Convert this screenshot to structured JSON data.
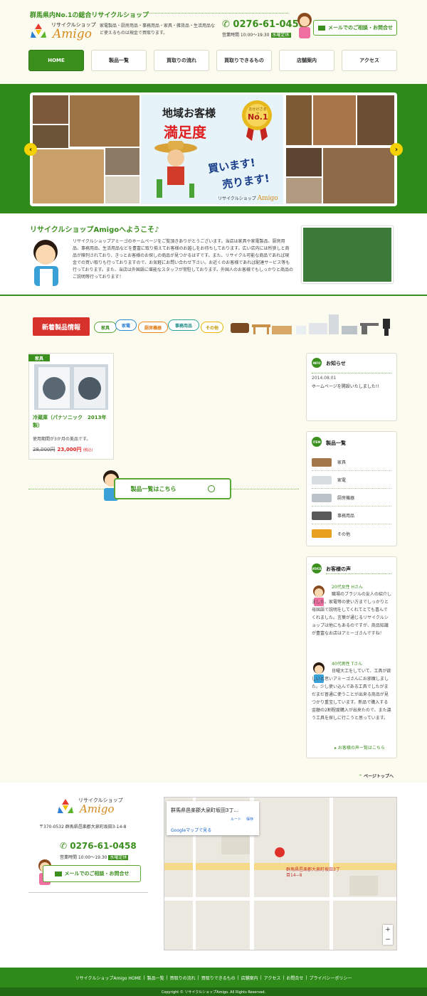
{
  "header": {
    "tagline": "群馬県内No.1の総合リサイクルショップ",
    "logo_sub": "リサイクルショップ",
    "logo_main": "Amigo",
    "description": "家電製品・厨房用品・事務用品・家具・雑貨品・生活用品など使えるものは現金で買取ります。",
    "phone": "0276-61-0458",
    "hours": "営業時間 10:00～19:30",
    "closed": "水曜定休",
    "mail_button": "メールでのご相談・お問合せ"
  },
  "nav": [
    {
      "label": "HOME",
      "active": true
    },
    {
      "label": "製品一覧"
    },
    {
      "label": "買取りの流れ"
    },
    {
      "label": "買取りできるもの"
    },
    {
      "label": "店舗案内"
    },
    {
      "label": "アクセス"
    }
  ],
  "banner": {
    "title1": "地域お客様",
    "title2": "満足度",
    "medal_top": "おかげさまで",
    "medal_no": "No.1",
    "kaimasu": "買います!",
    "urimasu": "売ります!",
    "logo_sub": "リサイクルショップ",
    "logo_main": "Amigo",
    "prev_arrow": "‹",
    "next_arrow": "›"
  },
  "welcome": {
    "title": "リサイクルショップAmigoへようこそ♪",
    "text": "リサイクルショップアミーゴのホームページをご覧頂きありがとうございます。当店は家具や家電製品、厨房用品、事務用品、生活用品などを豊富に取り揃えてお客様のお越しをお待ちしております。広い店内には所狭しと商品が陳列されており、きっとお客様のお探しの商品が見つかるはずです。また、リサイクル可能な商品であれば現金での買い取りも行っておりますので、お気軽にお問い合わせ下さい。お近くのお客様であれば配達サービス等も行っております。また、当店は外国語に堪能なスタッフが常駐しております。外国人のお客様でもしっかりと商品のご説明等行っております！"
  },
  "new_items": {
    "label": "新着製品情報",
    "categories": [
      "家具",
      "家電",
      "厨房機器",
      "事務用品",
      "その他"
    ]
  },
  "product": {
    "tag": "家具",
    "name": "冷蔵庫（パナソニック　2013年製）",
    "note": "使用期間が3か月の美品です。",
    "old_price": "28,000円",
    "new_price": "23,000円",
    "tax": "(税込)"
  },
  "list_button": "製品一覧はこちら",
  "sidebar": {
    "info_badge": "INFO",
    "info_title": "お知らせ",
    "info_date": "2014.08.01",
    "info_text": "ホームページを開設いたしました!!",
    "item_badge": "ITEM",
    "item_title": "製品一覧",
    "items": [
      "家具",
      "家電",
      "厨房機器",
      "事務用品",
      "その他"
    ],
    "voice_badge": "VOICE",
    "voice_title": "お客様の声",
    "voices": [
      {
        "author": "20代女性 Hさん",
        "text": "職場のブラジルの友人の紹介しました。家電等の使い方までしっかりと母国語で説明をしてくれてとても喜んでくれました。言葉が通じるリサイクルショップは他にもあるのですが、商品知識が豊富なお店はアミーゴさんですね！"
      },
      {
        "author": "40代男性 Tさん",
        "text": "日曜大工をしていて、工具が欲しいと思いアミーゴさんにお邪魔しました。少し使い込んである工具でしたがまだまだ普通に使うことが出来る商品が見つかり重宝しています。新品で購入する金額の2割程度購入が出来たので、また違う工具を探しに行こうと思っています。"
      }
    ],
    "voice_more": "お客様の声一覧はこちら"
  },
  "page_top": "ページトップへ",
  "footer": {
    "logo_sub": "リサイクルショップ",
    "logo_main": "Amigo",
    "address": "〒370-0532 群馬県邑楽郡大泉町坂田3-14-8",
    "phone": "0276-61-0458",
    "hours": "営業時間 10:00～19:30",
    "closed": "水曜定休",
    "mail_button": "メールでのご相談・お問合せ",
    "map_title": "群馬県邑楽郡大泉町坂田3丁...",
    "map_link": "Googleマップで見る",
    "map_route": "ルート",
    "map_save": "保存",
    "map_pin_label": "群馬県邑楽郡大泉町坂田3丁目14−8",
    "links": [
      "リサイクルショップAmigo HOME",
      "製品一覧",
      "買取りの流れ",
      "買取りできるもの",
      "店舗案内",
      "アクセス",
      "お問合せ",
      "プライバシーポリシー"
    ],
    "copyright": "Copyright © リサイクルショップAmigo. All Rights Reserved."
  },
  "colors": {
    "brand_green": "#3a8f1d",
    "accent_red": "#e02020",
    "logo_orange": "#d68a1c",
    "arrow_yellow": "#f5d100"
  }
}
